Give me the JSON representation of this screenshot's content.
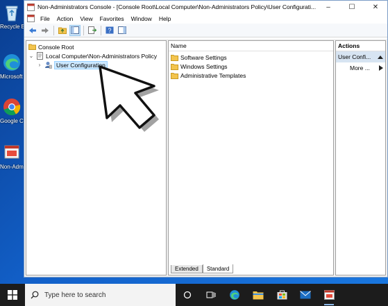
{
  "desktop": {
    "icons": [
      {
        "label": "Recycle Bin",
        "name": "recycle-bin"
      },
      {
        "label": "Microsoft Edge",
        "name": "edge"
      },
      {
        "label": "Google Chrome",
        "name": "chrome"
      },
      {
        "label": "Non-Administrators Console",
        "name": "console-shortcut"
      }
    ]
  },
  "window": {
    "title": "Non-Administrators Console - [Console Root\\Local Computer\\Non-Administrators Policy\\User Configurati...",
    "controls": {
      "minimize": "–",
      "maximize": "☐",
      "close": "✕"
    }
  },
  "menubar": {
    "items": [
      "File",
      "Action",
      "View",
      "Favorites",
      "Window",
      "Help"
    ]
  },
  "tree": {
    "root": "Console Root",
    "policy": "Local Computer\\Non-Administrators Policy",
    "user_config": "User Configuration"
  },
  "list": {
    "column": "Name",
    "items": [
      "Software Settings",
      "Windows Settings",
      "Administrative Templates"
    ],
    "tabs": [
      "Extended",
      "Standard"
    ]
  },
  "actions": {
    "title": "Actions",
    "section": "User Confi...",
    "more": "More ..."
  },
  "taskbar": {
    "search_placeholder": "Type here to search"
  }
}
